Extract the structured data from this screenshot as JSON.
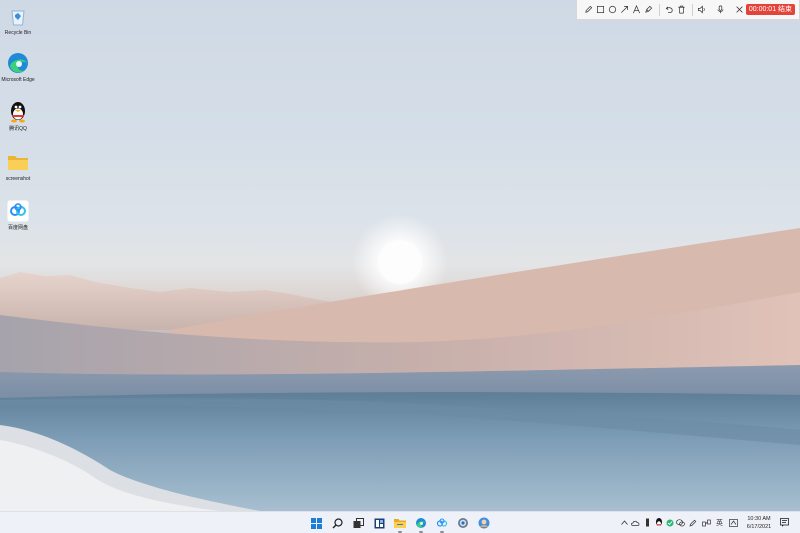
{
  "desktop": {
    "icons": [
      {
        "label": "Recycle Bin",
        "icon": "recycle-bin-icon"
      },
      {
        "label": "Microsoft Edge",
        "icon": "edge-icon"
      },
      {
        "label": "腾讯QQ",
        "icon": "qq-penguin-icon"
      },
      {
        "label": "screenshot",
        "icon": "folder-icon"
      },
      {
        "label": "百度网盘",
        "icon": "baidu-netdisk-icon"
      }
    ]
  },
  "recorder": {
    "tools": [
      "pen-icon",
      "rectangle-icon",
      "ellipse-icon",
      "arrow-icon",
      "text-icon",
      "highlighter-icon",
      "undo-icon",
      "delete-icon",
      "speaker-icon",
      "microphone-icon",
      "close-icon"
    ],
    "timer_label": "00:00:01 结束",
    "accent": "#e4433a"
  },
  "taskbar": {
    "apps": [
      "start-icon",
      "search-icon",
      "task-view-icon",
      "widgets-icon",
      "file-explorer-icon",
      "edge-icon",
      "baidu-netdisk-icon",
      "settings-icon",
      "avatar-icon"
    ],
    "tray": {
      "ime": "英",
      "time": "10:30 AM",
      "date": "6/17/2021"
    }
  }
}
